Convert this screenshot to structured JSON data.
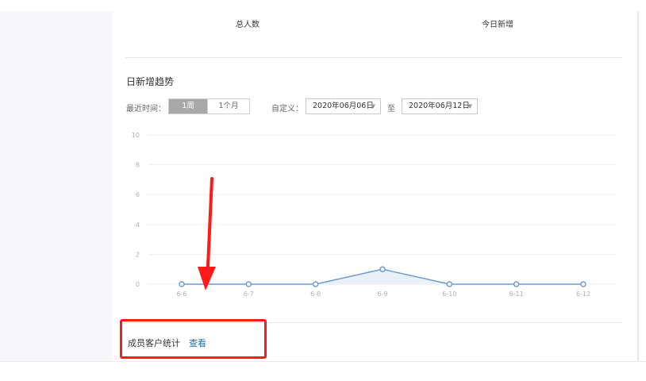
{
  "stats": {
    "total_label": "总人数",
    "today_label": "今日新增"
  },
  "trend": {
    "title": "日新增趋势",
    "filter_label": "最近时间：",
    "range_week": "1周",
    "range_month": "1个月",
    "custom_label": "自定义：",
    "date_start": "2020年06月06日",
    "to_label": "至",
    "date_end": "2020年06月12日",
    "dropdown_icon": "caret-down-icon"
  },
  "chart_data": {
    "type": "area",
    "categories": [
      "6-6",
      "6-7",
      "6-8",
      "6-9",
      "6-10",
      "6-11",
      "6-12"
    ],
    "values": [
      0,
      0,
      0,
      1,
      0,
      0,
      0
    ],
    "y_ticks": [
      "0",
      "2",
      "4",
      "6",
      "8",
      "10"
    ],
    "ylim": [
      0,
      10
    ],
    "title": "",
    "xlabel": "",
    "ylabel": "",
    "grid": true,
    "line_color": "#6f9ccc",
    "fill_color": "#eaf0f7"
  },
  "members": {
    "title": "成员客户统计",
    "view_link": "查看"
  },
  "annotation": {
    "color": "#ff1a1a"
  }
}
